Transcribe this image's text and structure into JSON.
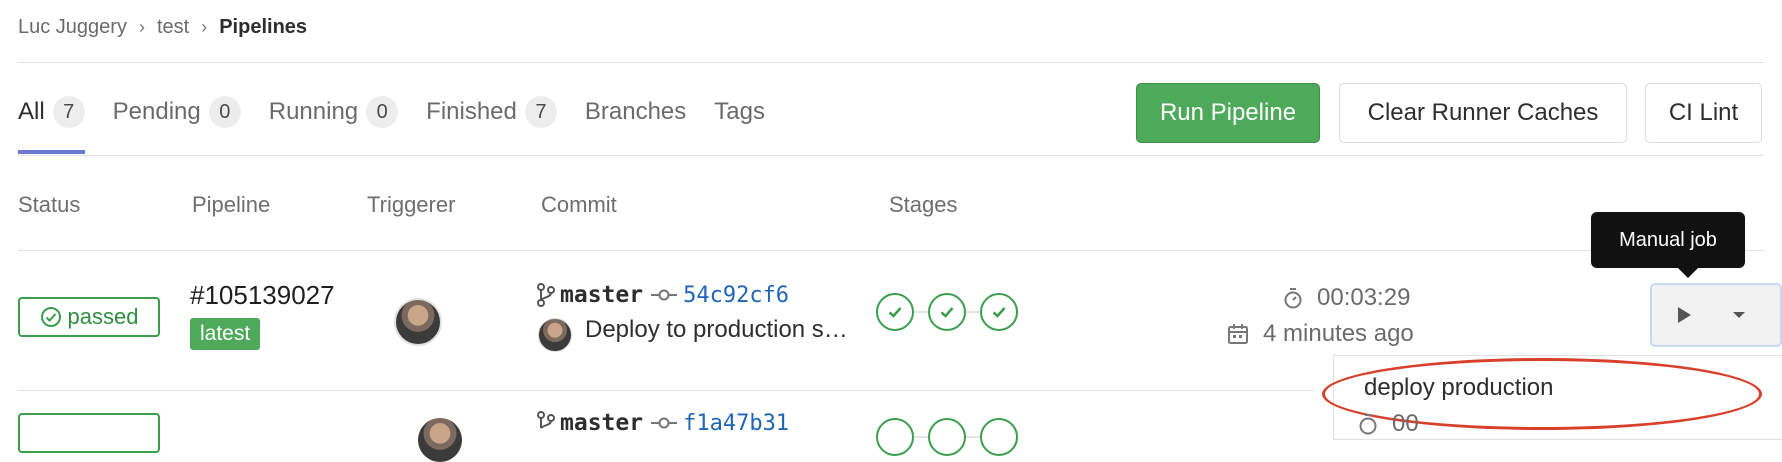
{
  "breadcrumb": {
    "items": [
      "Luc Juggery",
      "test"
    ],
    "current": "Pipelines",
    "separator": "›"
  },
  "tabs": [
    {
      "label": "All",
      "count": "7",
      "active": true
    },
    {
      "label": "Pending",
      "count": "0"
    },
    {
      "label": "Running",
      "count": "0"
    },
    {
      "label": "Finished",
      "count": "7"
    },
    {
      "label": "Branches"
    },
    {
      "label": "Tags"
    }
  ],
  "actions": {
    "run_pipeline": "Run Pipeline",
    "clear_caches": "Clear Runner Caches",
    "ci_lint": "CI Lint"
  },
  "table": {
    "headers": {
      "status": "Status",
      "pipeline": "Pipeline",
      "triggerer": "Triggerer",
      "commit": "Commit",
      "stages": "Stages"
    },
    "rows": [
      {
        "status": "passed",
        "pipeline_id": "#105139027",
        "tag": "latest",
        "branch": "master",
        "sha": "54c92cf6",
        "commit_title": "Deploy to production s…",
        "duration": "00:03:29",
        "finished": "4 minutes ago"
      },
      {
        "branch": "master",
        "sha": "f1a47b31",
        "duration_partial": "00"
      }
    ]
  },
  "tooltip": "Manual job",
  "dropdown": {
    "items": [
      "deploy production"
    ]
  },
  "colors": {
    "success": "#3a9e4c",
    "primary_button": "#4fa95a",
    "tab_underline": "#6b78d6",
    "link": "#1f67b6",
    "highlight_ring": "#d9402c"
  }
}
